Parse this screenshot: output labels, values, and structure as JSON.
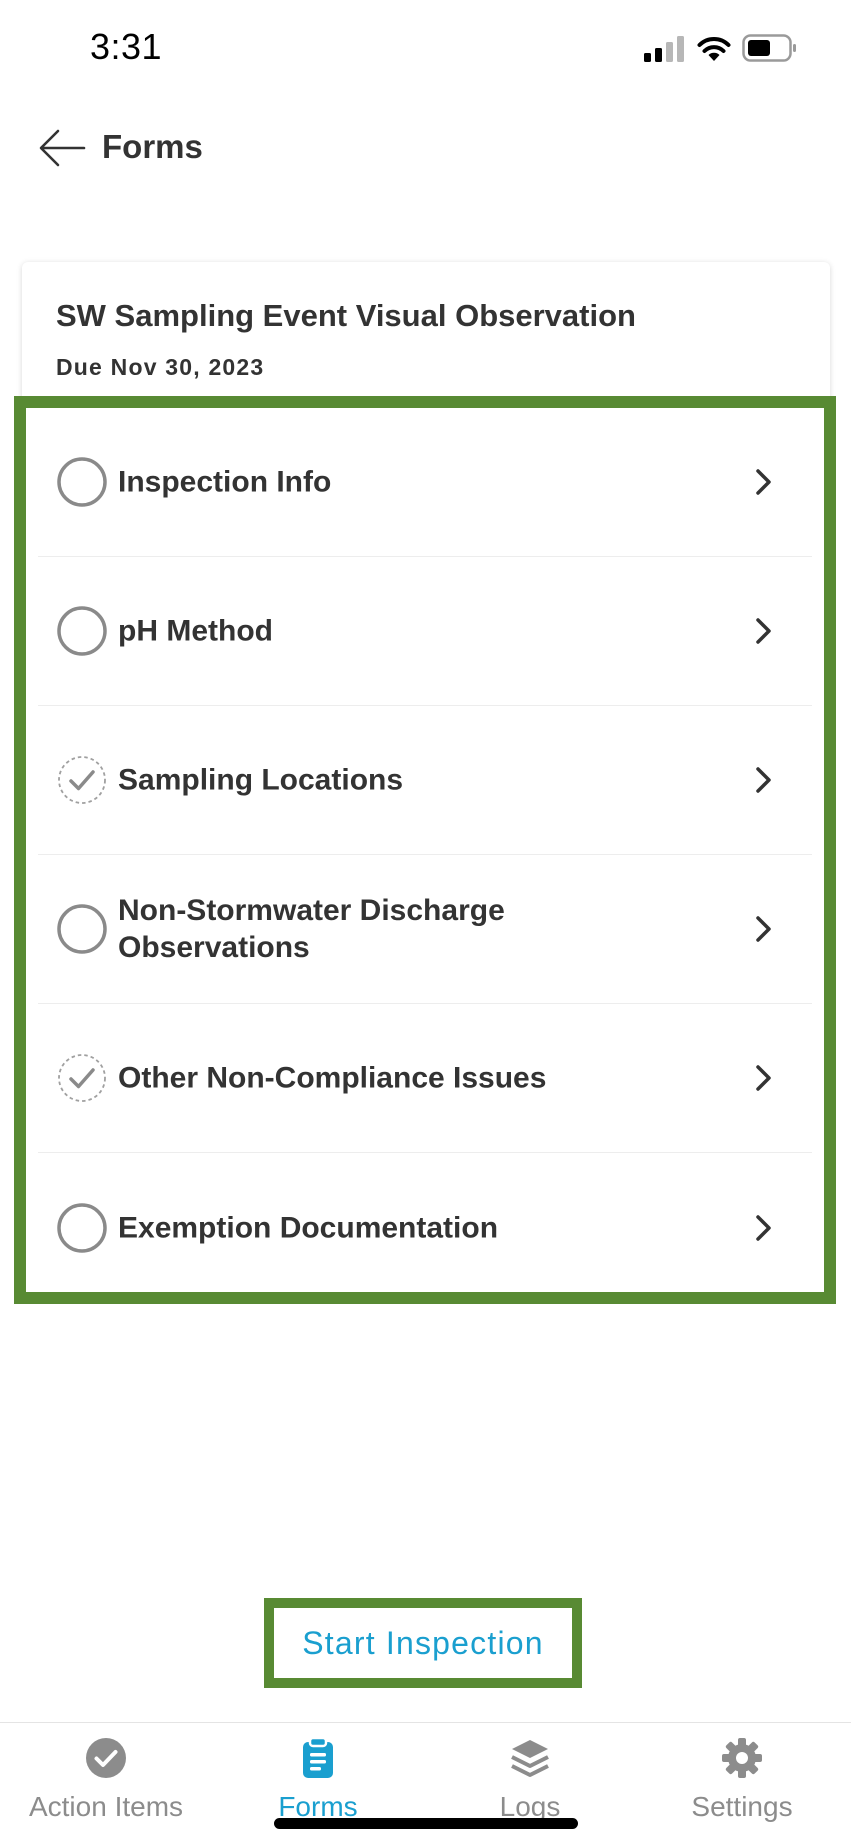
{
  "status_bar": {
    "time": "3:31"
  },
  "header": {
    "title": "Forms",
    "back_icon": "arrow-left-icon"
  },
  "form": {
    "title": "SW Sampling Event Visual Observation",
    "due": "Due Nov 30, 2023"
  },
  "sections": [
    {
      "label": "Inspection Info",
      "status": "incomplete"
    },
    {
      "label": "pH Method",
      "status": "incomplete"
    },
    {
      "label": "Sampling Locations",
      "status": "optional-complete"
    },
    {
      "label": "Non-Stormwater Discharge Observations",
      "status": "incomplete"
    },
    {
      "label": "Other Non-Compliance Issues",
      "status": "optional-complete"
    },
    {
      "label": "Exemption Documentation",
      "status": "incomplete"
    }
  ],
  "actions": {
    "start_label": "Start Inspection"
  },
  "tab_bar": {
    "tabs": [
      {
        "label": "Action Items",
        "icon": "check-circle-icon",
        "active": false
      },
      {
        "label": "Forms",
        "icon": "clipboard-icon",
        "active": true
      },
      {
        "label": "Logs",
        "icon": "layers-icon",
        "active": false
      },
      {
        "label": "Settings",
        "icon": "gear-icon",
        "active": false
      }
    ]
  },
  "colors": {
    "accent": "#1a9fcf",
    "highlight": "#588a33",
    "text": "#333333",
    "muted": "#8c8c8c"
  }
}
